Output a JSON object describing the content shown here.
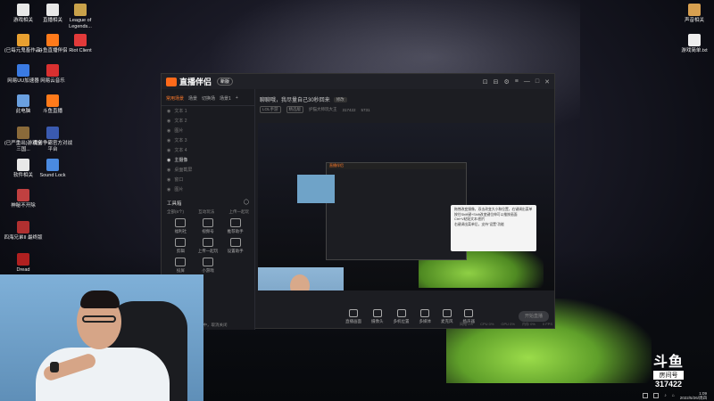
{
  "desktop": {
    "left_icons": [
      {
        "label": "游戏相关",
        "color": "#e8e8e8"
      },
      {
        "label": "直播相关",
        "color": "#e8e8e8"
      },
      {
        "label": "League of Legends...",
        "color": "#c9a24a"
      },
      {
        "label": "(已每元鬼畜作品)",
        "color": "#e8a030"
      },
      {
        "label": "斗鱼直播伴侣",
        "color": "#ff7a1a"
      },
      {
        "label": "Riot Client",
        "color": "#e23a3a"
      },
      {
        "label": "网易UU加速器",
        "color": "#3a7ae2"
      },
      {
        "label": "网易云音乐",
        "color": "#d93030"
      },
      {
        "label": "此电脑",
        "color": "#6aa0e0"
      },
      {
        "label": "斗鱼直播",
        "color": "#ff7a1a"
      },
      {
        "label": "(已严重出)游戏全三国...",
        "color": "#8a6a3a"
      },
      {
        "label": "魔兽争霸官方对战平台",
        "color": "#3a5ab0"
      },
      {
        "label": "软件相关",
        "color": "#e8e8e8"
      },
      {
        "label": "Sound Lock",
        "color": "#4a8ae0"
      },
      {
        "label": "神秘不开除",
        "color": "#c04040"
      },
      {
        "label": "四海兄弟II 最终版",
        "color": "#b03030"
      },
      {
        "label": "Dread",
        "color": "#b02020"
      }
    ],
    "right_icons": [
      {
        "label": "声音相关",
        "color": "#d8a050"
      },
      {
        "label": "游戏简单.txt",
        "color": "#eeeeee"
      }
    ]
  },
  "app": {
    "name": "直播伴侣",
    "version": "新版",
    "window_controls": [
      "⊡",
      "⊟",
      "⚙",
      "≡",
      "—",
      "□",
      "✕"
    ],
    "sidebar": {
      "tabs": [
        "常用场景",
        "场景",
        "切换场",
        "场景1",
        "+"
      ],
      "sources": [
        {
          "label": "文本 1",
          "on": false
        },
        {
          "label": "文本 2",
          "on": false
        },
        {
          "label": "图片",
          "on": false
        },
        {
          "label": "文本 3",
          "on": false
        },
        {
          "label": "文本 4",
          "on": false
        },
        {
          "label": "主摄像",
          "on": true
        },
        {
          "label": "桌面截屏",
          "on": false
        },
        {
          "label": "窗口",
          "on": false
        },
        {
          "label": "图片",
          "on": false
        }
      ],
      "toolbox_title": "工具箱",
      "toolbox_tabs": [
        "全部(6个)",
        "互动玩法",
        "上传一起玩"
      ],
      "tools": [
        {
          "label": "福利社"
        },
        {
          "label": "视频号"
        },
        {
          "label": "推荐助手"
        },
        {
          "label": "剪辑"
        },
        {
          "label": "上传一起玩"
        },
        {
          "label": "设置助手"
        },
        {
          "label": "投屏"
        },
        {
          "label": "小游戏"
        }
      ],
      "footer": "斗鱼不在线主播处理中，取消关闭"
    },
    "main": {
      "room_title": "聊聊哦，我尽量自己30秒回来",
      "room_tag": "修改",
      "category": "LOL手游",
      "subcategory": "精选版",
      "streamer": "护猫大师玩大王",
      "room_id": "317422",
      "viewers": "5731",
      "tooltip_lines": [
        "拖拽改变镜像，双击改变大小和位置，右键调出菜单",
        "按住Shift键+Shift改变键位伸可以推按画面",
        "Ctrl+V粘贴文本/图片",
        "右键调出菜单后，支持\"设置\"功能"
      ],
      "controls": [
        "直播画面",
        "摄像头",
        "多机位置",
        "多媒体",
        "麦克风",
        "扬声器"
      ],
      "go_live": "开始直播",
      "status": [
        "网络 0%",
        "CPU 0%",
        "GPU 0%",
        "内存 0%",
        "0 FPS"
      ]
    }
  },
  "overlay": {
    "brand_line1": "斗鱼",
    "brand_line2": "房间号",
    "room_number": "317422"
  },
  "tray": {
    "time": "1:09",
    "date": "2022/5/26/周四"
  }
}
